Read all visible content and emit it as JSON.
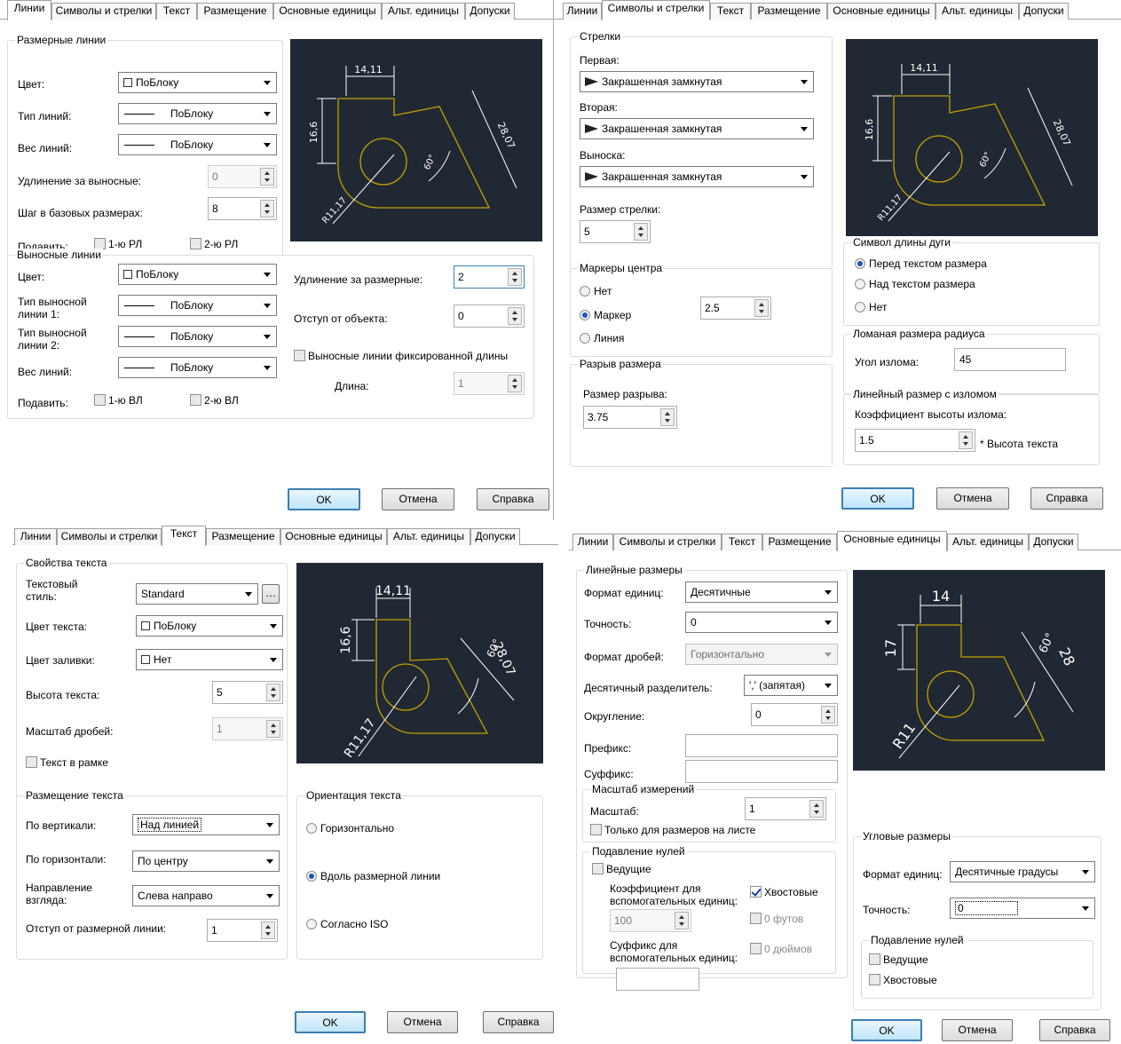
{
  "tabs": [
    "Линии",
    "Символы и стрелки",
    "Текст",
    "Размещение",
    "Основные единицы",
    "Альт. единицы",
    "Допуски"
  ],
  "common": {
    "ok": "OK",
    "cancel": "Отмена",
    "help": "Справка",
    "byblock": "ПоБлоку",
    "colors": {
      "preview_bg": "#1f2833",
      "geometry": "#c8a000",
      "dims": "#ffffff",
      "default_btn": "#3c7fb1"
    }
  },
  "lines": {
    "dim_group": "Размерные линии",
    "color_lbl": "Цвет:",
    "linetype_lbl": "Тип линий:",
    "weight_lbl": "Вес линий:",
    "ext_beyond_lbl": "Удлинение за выносные:",
    "ext_beyond_val": "0",
    "baseline_lbl": "Шаг в базовых размерах:",
    "baseline_val": "8",
    "suppress_lbl": "Подавить:",
    "suppress1": "1-ю РЛ",
    "suppress2": "2-ю РЛ",
    "ext_group": "Выносные линии",
    "ext_color_lbl": "Цвет:",
    "ext_lt1_lbl": "Тип выносной линии 1:",
    "ext_lt2_lbl": "Тип выносной линии 2:",
    "ext_weight_lbl": "Вес линий:",
    "ext_suppress_lbl": "Подавить:",
    "ext_suppress1": "1-ю ВЛ",
    "ext_suppress2": "2-ю ВЛ",
    "ext_beyond_dim_lbl": "Удлинение за размерные:",
    "ext_beyond_dim_val": "2",
    "offset_lbl": "Отступ от объекта:",
    "offset_val": "0",
    "fixed_len_lbl": "Выносные линии фиксированной длины",
    "length_lbl": "Длина:",
    "length_val": "1",
    "preview": {
      "top": "14,11",
      "left": "16,6",
      "right": "28,07",
      "angle": "60°",
      "radius": "R11,17"
    }
  },
  "symbols": {
    "arrows_group": "Стрелки",
    "first_lbl": "Первая:",
    "second_lbl": "Вторая:",
    "leader_lbl": "Выноска:",
    "arrow_val": "Закрашенная замкнутая",
    "size_lbl": "Размер стрелки:",
    "size_val": "5",
    "center_group": "Маркеры центра",
    "center_none": "Нет",
    "center_mark": "Маркер",
    "center_line": "Линия",
    "center_val": "2.5",
    "break_group": "Разрыв размера",
    "break_lbl": "Размер разрыва:",
    "break_val": "3.75",
    "arc_group": "Символ длины дуги",
    "arc_before": "Перед текстом размера",
    "arc_above": "Над текстом размера",
    "arc_none": "Нет",
    "jog_group": "Ломаная размера радиуса",
    "jog_lbl": "Угол излома:",
    "jog_val": "45",
    "linjog_group": "Линейный размер с изломом",
    "linjog_lbl": "Коэффициент высоты излома:",
    "linjog_val": "1.5",
    "linjog_suffix": "* Высота текста",
    "preview": {
      "top": "14,11",
      "left": "16,6",
      "right": "28,07",
      "angle": "60°",
      "radius": "R11,17"
    }
  },
  "text": {
    "props_group": "Свойства текста",
    "style_lbl": "Текстовый стиль:",
    "style_val": "Standard",
    "color_lbl": "Цвет текста:",
    "color_val": "ПоБлоку",
    "fill_lbl": "Цвет заливки:",
    "fill_val": "Нет",
    "height_lbl": "Высота текста:",
    "height_val": "5",
    "frac_lbl": "Масштаб дробей:",
    "frac_val": "1",
    "frame_lbl": "Текст в рамке",
    "place_group": "Размещение текста",
    "vert_lbl": "По вертикали:",
    "vert_val": "Над линией",
    "horiz_lbl": "По горизонтали:",
    "horiz_val": "По центру",
    "dir_lbl": "Направление взгляда:",
    "dir_val": "Слева направо",
    "offset_lbl": "Отступ от размерной линии:",
    "offset_val": "1",
    "orient_group": "Ориентация текста",
    "orient_h": "Горизонтально",
    "orient_along": "Вдоль размерной линии",
    "orient_iso": "Согласно ISO",
    "preview": {
      "top": "14,11",
      "left": "16,6",
      "right": "28,07",
      "angle": "60°",
      "radius": "R11,17"
    }
  },
  "units": {
    "linear_group": "Линейные размеры",
    "format_lbl": "Формат единиц:",
    "format_val": "Десятичные",
    "prec_lbl": "Точность:",
    "prec_val": "0",
    "frac_lbl": "Формат дробей:",
    "frac_val": "Горизонтально",
    "sep_lbl": "Десятичный разделитель:",
    "sep_val": "',' (запятая)",
    "round_lbl": "Округление:",
    "round_val": "0",
    "prefix_lbl": "Префикс:",
    "suffix_lbl": "Суффикс:",
    "scale_group": "Масштаб измерений",
    "scale_lbl": "Масштаб:",
    "scale_val": "1",
    "layout_only": "Только для размеров на листе",
    "zero_group": "Подавление нулей",
    "leading": "Ведущие",
    "trailing": "Хвостовые",
    "sub_factor_lbl": "Коэффициент для вспомогательных единиц:",
    "sub_factor_val": "100",
    "feet": "0 футов",
    "inches": "0 дюймов",
    "sub_suffix_lbl": "Суффикс для вспомогательных единиц:",
    "ang_group": "Угловые размеры",
    "ang_format_lbl": "Формат единиц:",
    "ang_format_val": "Десятичные градусы",
    "ang_prec_lbl": "Точность:",
    "ang_prec_val": "0",
    "ang_zero_group": "Подавление нулей",
    "ang_leading": "Ведущие",
    "ang_trailing": "Хвостовые",
    "preview": {
      "top": "14",
      "left": "17",
      "right": "28",
      "angle": "60°",
      "radius": "R11"
    }
  }
}
